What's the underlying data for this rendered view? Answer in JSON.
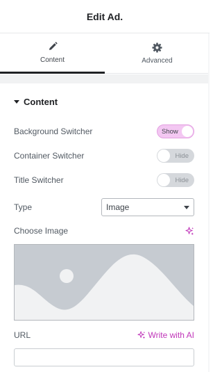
{
  "header": {
    "title": "Edit Ad."
  },
  "tabs": [
    {
      "label": "Content",
      "icon": "pencil-icon",
      "active": true
    },
    {
      "label": "Advanced",
      "icon": "gear-icon",
      "active": false
    }
  ],
  "section": {
    "title": "Content"
  },
  "controls": {
    "background_switcher": {
      "label": "Background Switcher",
      "state_text": "Show"
    },
    "container_switcher": {
      "label": "Container Switcher",
      "state_text": "Hide"
    },
    "title_switcher": {
      "label": "Title Switcher",
      "state_text": "Hide"
    },
    "type": {
      "label": "Type",
      "value": "Image"
    },
    "choose_image": {
      "label": "Choose Image",
      "icon": "ai-sparkle-icon"
    },
    "url": {
      "label": "URL",
      "ai_label": "Write with AI",
      "value": ""
    }
  },
  "colors": {
    "accent": "#c036b9",
    "switch_on_bg": "#f3c7f2",
    "switch_off_bg": "#d5d8dc",
    "placeholder_bg": "#c6cbd1"
  }
}
